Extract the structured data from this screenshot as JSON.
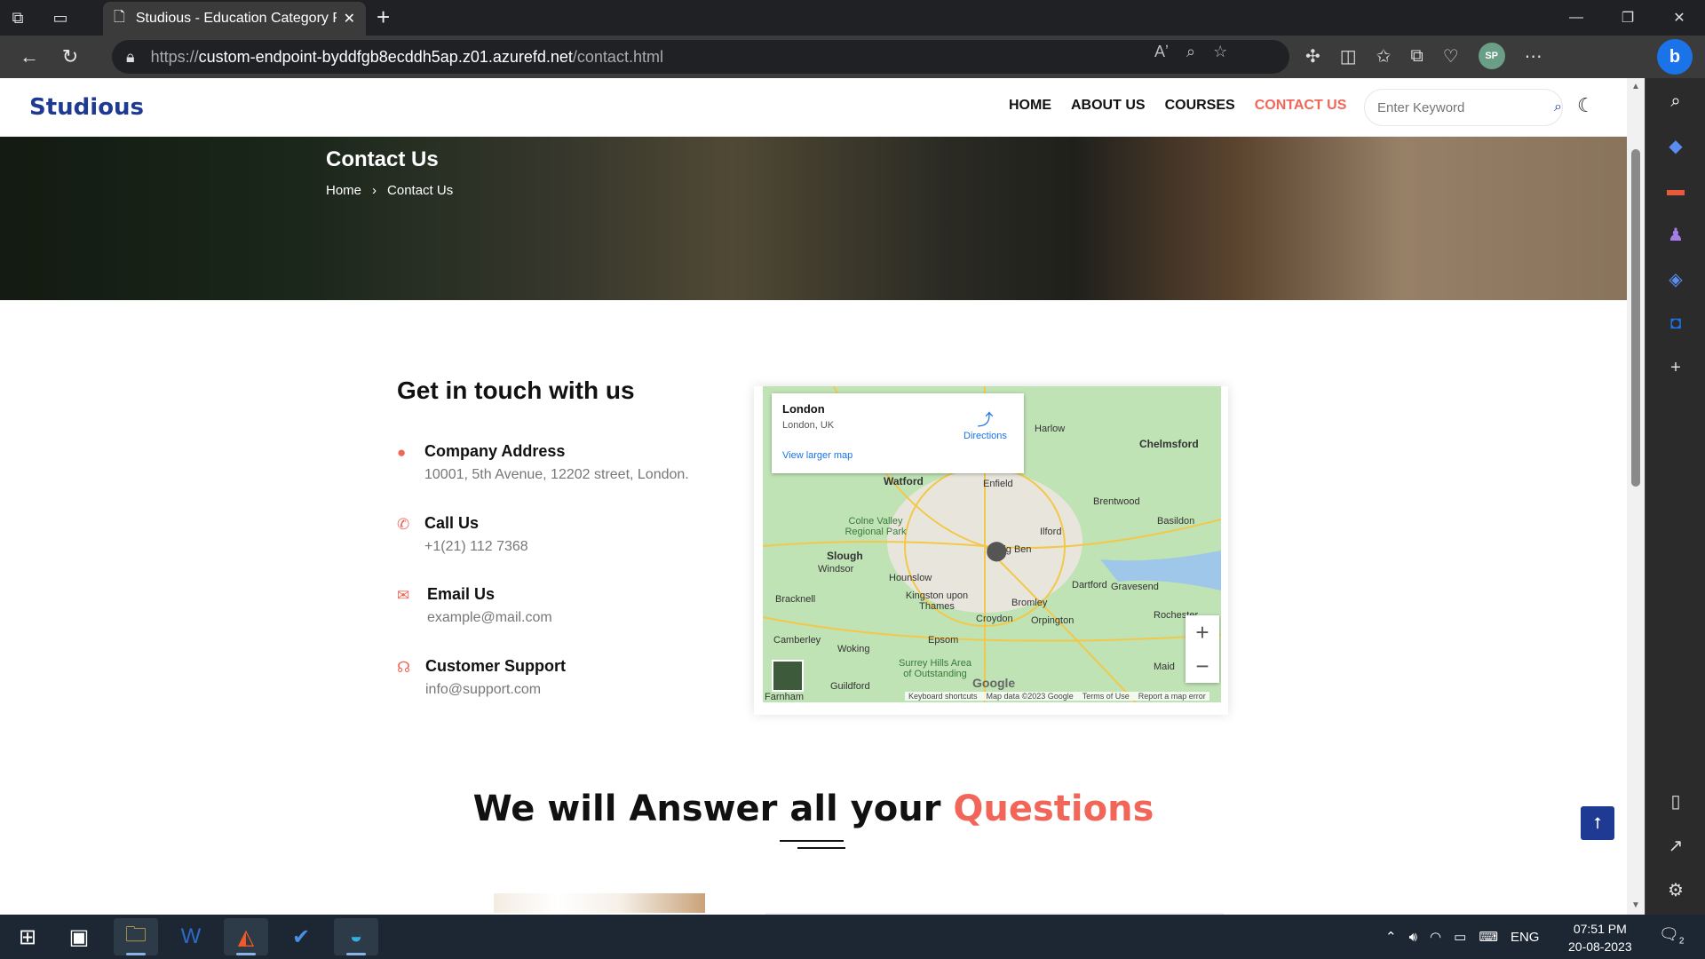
{
  "browser": {
    "tab_title": "Studious - Education Category R",
    "url_scheme": "https://",
    "url_domain": "custom-endpoint-byddfgb8ecddh5ap.z01.azurefd.net",
    "url_path": "/contact.html",
    "profile_initials": "SP"
  },
  "site": {
    "logo": "Studious",
    "nav": [
      "HOME",
      "ABOUT US",
      "COURSES",
      "CONTACT US"
    ],
    "search_placeholder": "Enter Keyword"
  },
  "hero": {
    "title": "Contact Us",
    "breadcrumb_home": "Home",
    "breadcrumb_current": "Contact Us"
  },
  "contact": {
    "title": "Get in touch with us",
    "items": [
      {
        "label": "Company Address",
        "value": "10001, 5th Avenue, 12202 street, London.",
        "icon": "globe-icon"
      },
      {
        "label": "Call Us",
        "value": "+1(21) 112 7368",
        "icon": "phone-icon"
      },
      {
        "label": "Email Us",
        "value": "example@mail.com",
        "icon": "envelope-icon"
      },
      {
        "label": "Customer Support",
        "value": "info@support.com",
        "icon": "headset-icon"
      }
    ]
  },
  "map": {
    "place_name": "London",
    "place_sub": "London, UK",
    "directions": "Directions",
    "larger_map": "View larger map",
    "labels": [
      "Watford",
      "Enfield",
      "Harlow",
      "Chelmsford",
      "Brentwood",
      "Basildon",
      "Colne Valley Regional Park",
      "Ilford",
      "Slough",
      "Windsor",
      "Hounslow",
      "Big Ben",
      "Dartford",
      "Gravesend",
      "Kingston upon Thames",
      "Bromley",
      "Bracknell",
      "Croydon",
      "Orpington",
      "Rochester",
      "Camberley",
      "Woking",
      "Epsom",
      "Surrey Hills Area of Outstanding",
      "Guildford",
      "Farnham",
      "Maid"
    ],
    "footer": [
      "Keyboard shortcuts",
      "Map data ©2023 Google",
      "Terms of Use",
      "Report a map error"
    ],
    "google": "Google"
  },
  "section": {
    "questions_prefix": "We will Answer all your",
    "questions_accent": "Questions"
  },
  "taskbar": {
    "lang": "ENG",
    "time": "07:51 PM",
    "date": "20-08-2023",
    "notifications": "2"
  },
  "colors": {
    "accent": "#f2665a",
    "brand": "#1f3a93"
  }
}
